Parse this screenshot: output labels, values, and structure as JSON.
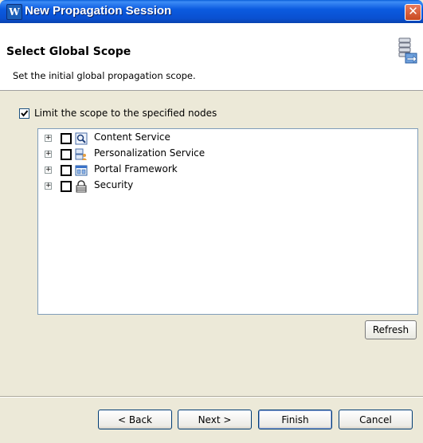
{
  "window": {
    "title": "New Propagation Session",
    "close_glyph": "✕"
  },
  "header": {
    "title": "Select Global Scope",
    "description": "Set the initial global propagation scope."
  },
  "scope_option": {
    "label": "Limit the scope to the specified nodes",
    "checked": true
  },
  "tree": {
    "nodes": [
      {
        "label": "Content Service",
        "icon": "content-service-icon",
        "expanded": false,
        "checked": false
      },
      {
        "label": "Personalization Service",
        "icon": "personalization-service-icon",
        "expanded": false,
        "checked": false
      },
      {
        "label": "Portal Framework",
        "icon": "portal-framework-icon",
        "expanded": false,
        "checked": false
      },
      {
        "label": "Security",
        "icon": "security-icon",
        "expanded": false,
        "checked": false
      }
    ]
  },
  "buttons": {
    "refresh": "Refresh",
    "back": "< Back",
    "next": "Next >",
    "finish": "Finish",
    "cancel": "Cancel"
  }
}
